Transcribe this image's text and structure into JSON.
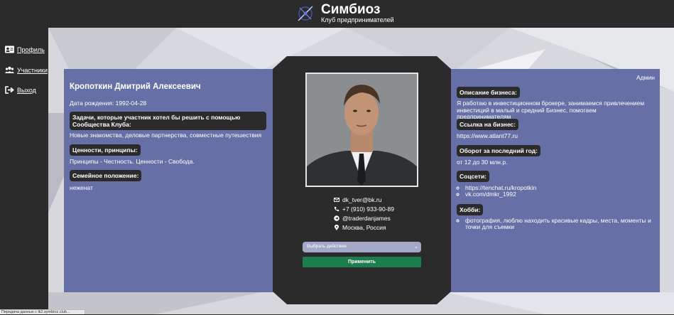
{
  "brand": {
    "title": "Симбиоз",
    "subtitle": "Клуб предпринимателей"
  },
  "sidebar": {
    "items": [
      {
        "label": "Профиль",
        "icon": "id-card-icon"
      },
      {
        "label": "Участники",
        "icon": "users-icon"
      },
      {
        "label": "Выход",
        "icon": "logout-icon"
      }
    ]
  },
  "profile": {
    "name": "Кропоткин Дмитрий Алексеевич",
    "birth": "Дата рождения: 1992-04-28",
    "role": "Админ",
    "tasks_label": "Задачи, которые участник хотел бы решить с помощью Сообщества Клуба:",
    "tasks_value": "Новые знакомства, деловые партнерства, совместные путешествия",
    "values_label": "Ценности, принципы:",
    "values_value": "Принципы - Честность. Ценности - Свобода.",
    "family_label": "Семейное положение:",
    "family_value": "неженат"
  },
  "contacts": {
    "email": "dk_tver@bk.ru",
    "phone": "+7 (910) 933-90-89",
    "telegram": "@traderdanjames",
    "location": "Москва, Россия"
  },
  "actions": {
    "select_placeholder": "Выбрать действие",
    "apply_label": "Применить"
  },
  "business": {
    "desc_label": "Описание бизнеса:",
    "desc_value": "Я работаю в инвестиционном брокере, занимаемся привлечением инвестиций в малый и средний Бизнес, помогаем предпринимателям",
    "link_label": "Ссылка на бизнес:",
    "link_value": "https://www.atlant77.ru",
    "turnover_label": "Оборот за последний год:",
    "turnover_value": "от 12 до 30 млн.р.",
    "socials_label": "Соцсети:",
    "socials": [
      "https://tenchat.ru/kropotkin",
      "vk.com/dmkr_1992"
    ],
    "hobby_label": "Хобби:",
    "hobbies": [
      "фотография, люблю находить красивые кадры, места, моменты и точки для съемки"
    ]
  },
  "status": {
    "text": "Передача данных с lk2.symbioz.club..."
  },
  "colors": {
    "panel": "#6770a6",
    "dark": "#2b2b2b",
    "apply": "#1e7d4e"
  }
}
